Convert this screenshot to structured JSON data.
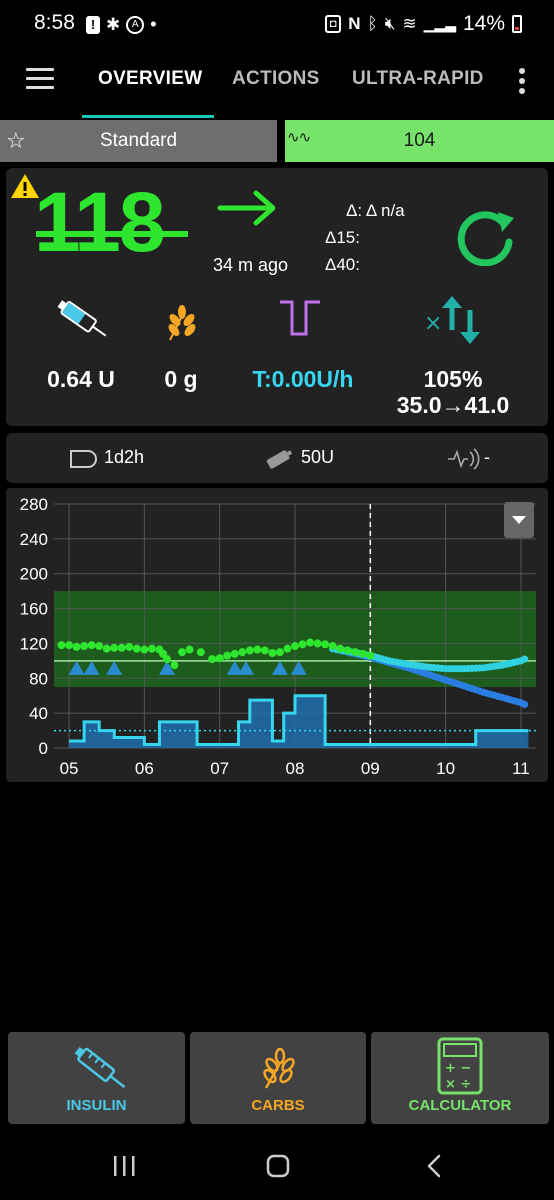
{
  "status_bar": {
    "time": "8:58",
    "battery": "14%",
    "notification_dot": "•"
  },
  "toolbar": {
    "tabs": [
      {
        "label": "OVERVIEW",
        "selected": true
      },
      {
        "label": "ACTIONS",
        "selected": false
      },
      {
        "label": "ULTRA-RAPID O",
        "selected": false
      }
    ]
  },
  "profile": {
    "name": "Standard"
  },
  "target": {
    "value": "104"
  },
  "glucose": {
    "value": "118",
    "time_ago": "34 m ago",
    "delta": "Δ: Δ n/a",
    "delta15": "Δ15:",
    "delta40": "Δ40:",
    "color": "#2ee62e",
    "trend": "flat"
  },
  "info": {
    "iob": "0.64 U",
    "cob": "0 g",
    "temp_basal": "T:0.00U/h",
    "autosens_pct": "105%",
    "autosens_range": "35.0→41.0"
  },
  "status_row": {
    "cannula_age": "1d2h",
    "reservoir": "50U",
    "sensor": "-"
  },
  "chart_data": {
    "type": "line",
    "x_tick_labels": [
      "05",
      "06",
      "07",
      "08",
      "09",
      "10",
      "11"
    ],
    "y_tick_labels": [
      "0",
      "40",
      "80",
      "120",
      "160",
      "200",
      "240",
      "280"
    ],
    "ylim": [
      0,
      280
    ],
    "target_range": [
      70,
      180
    ],
    "now_marker_x": 9.0,
    "reference_line": 100,
    "series": [
      {
        "kind": "bg",
        "x": [
          4.9,
          5.0,
          5.1,
          5.2,
          5.3,
          5.4,
          5.5,
          5.6,
          5.7,
          5.8,
          5.9,
          6.0,
          6.1,
          6.2,
          6.25,
          6.3,
          6.4,
          6.5,
          6.6,
          6.75,
          6.9,
          7.0,
          7.1,
          7.2,
          7.3,
          7.4,
          7.5,
          7.6,
          7.7,
          7.8,
          7.9,
          8.0,
          8.1,
          8.2,
          8.3,
          8.4,
          8.5,
          8.6,
          8.7,
          8.8,
          8.9,
          9.0
        ],
        "y": [
          118,
          118,
          116,
          117,
          118,
          117,
          114,
          115,
          115,
          116,
          114,
          113,
          114,
          113,
          108,
          102,
          95,
          110,
          113,
          110,
          102,
          103,
          106,
          108,
          110,
          112,
          113,
          112,
          109,
          110,
          114,
          117,
          119,
          121,
          120,
          119,
          117,
          114,
          112,
          110,
          108,
          106
        ]
      },
      {
        "kind": "prediction_high",
        "x": [
          8.5,
          8.75,
          9.0,
          9.25,
          9.5,
          9.75,
          10.0,
          10.25,
          10.5,
          10.75,
          11.0,
          11.1
        ],
        "y": [
          114,
          110,
          106,
          100,
          96,
          93,
          91,
          91,
          92,
          95,
          100,
          104
        ]
      },
      {
        "kind": "prediction_low",
        "x": [
          8.5,
          9.0,
          9.5,
          10.0,
          10.5,
          11.0,
          11.1
        ],
        "y": [
          114,
          104,
          92,
          78,
          64,
          52,
          48
        ]
      },
      {
        "kind": "basal",
        "x": [
          5.0,
          5.2,
          5.4,
          5.6,
          6.0,
          6.2,
          6.7,
          7.0,
          7.25,
          7.4,
          7.7,
          7.85,
          8.0,
          8.4,
          9.0,
          10.0,
          10.4,
          11.1
        ],
        "y": [
          8,
          30,
          20,
          12,
          4,
          30,
          4,
          4,
          30,
          55,
          8,
          40,
          60,
          4,
          4,
          4,
          20,
          20
        ]
      }
    ],
    "smb_markers_x": [
      5.1,
      5.3,
      5.6,
      6.3,
      7.2,
      7.35,
      7.8,
      8.05
    ],
    "basal_reference": 20
  },
  "buttons": {
    "insulin": "INSULIN",
    "carbs": "CARBS",
    "calculator": "CALCULATOR"
  }
}
